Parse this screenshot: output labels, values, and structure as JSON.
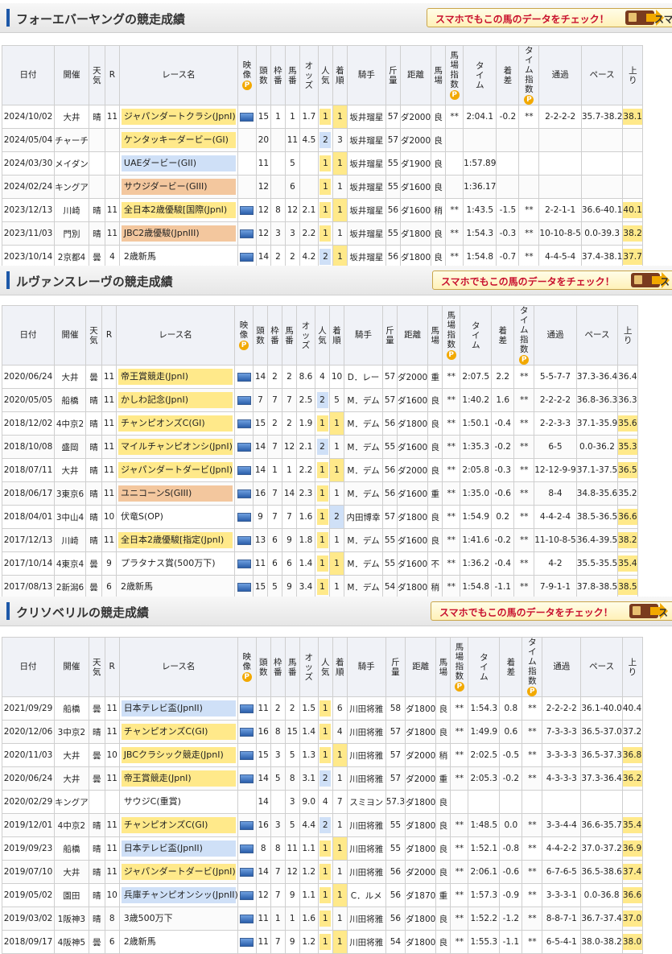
{
  "promo_text": "スマホでもこの馬のデータをチェック！",
  "promo_suffix": "スマ",
  "headers": {
    "date": "日付",
    "venue": "開催",
    "weather": "天気",
    "r": "R",
    "race": "レース名",
    "video": "映像",
    "heads": "頭数",
    "frame": "枠番",
    "horse": "馬番",
    "odds": "オッズ",
    "pop": "人気",
    "finish": "着順",
    "jockey": "騎手",
    "weight": "斤量",
    "distance": "距離",
    "track": "馬場",
    "track_index": "馬場指数",
    "time": "タイム",
    "margin": "着差",
    "time_index": "タイム指数",
    "passing": "通過",
    "pace": "ペース",
    "last3f": "上り",
    "p": "P"
  },
  "horses": [
    {
      "title": "フォーエバーヤングの競走成績",
      "rows": [
        [
          "2024/10/02",
          "大井",
          "晴",
          "11",
          "ジャパンダートクラシ(JpnI)",
          "g1",
          true,
          "15",
          "1",
          "1",
          "1.7",
          "1",
          "1",
          "坂井瑠星",
          "57",
          "ダ2000",
          "良",
          "**",
          "2:04.1",
          "-0.2",
          "**",
          "2-2-2-2",
          "35.7-38.2",
          "38.1"
        ],
        [
          "2024/05/04",
          "チャーチ",
          "",
          "",
          "ケンタッキーダービー(GI)",
          "g1",
          false,
          "20",
          "",
          "11",
          "4.5",
          "2",
          "3",
          "坂井瑠星",
          "57",
          "ダ2000",
          "良",
          "",
          "",
          "",
          "",
          "",
          "",
          ""
        ],
        [
          "2024/03/30",
          "メイダン",
          "",
          "",
          "UAEダービー(GII)",
          "g2",
          false,
          "11",
          "",
          "5",
          "",
          "1",
          "1",
          "坂井瑠星",
          "55",
          "ダ1900",
          "良",
          "",
          "1:57.89",
          "",
          "",
          "",
          "",
          ""
        ],
        [
          "2024/02/24",
          "キングア",
          "",
          "",
          "サウジダービー(GIII)",
          "g3",
          false,
          "12",
          "",
          "6",
          "",
          "1",
          "1",
          "坂井瑠星",
          "55",
          "ダ1600",
          "良",
          "",
          "1:36.17",
          "",
          "",
          "",
          "",
          ""
        ],
        [
          "2023/12/13",
          "川崎",
          "晴",
          "11",
          "全日本2歳優駿[国際(JpnI)",
          "g1",
          true,
          "12",
          "8",
          "12",
          "2.1",
          "1",
          "1",
          "坂井瑠星",
          "56",
          "ダ1600",
          "稍",
          "**",
          "1:43.5",
          "-1.5",
          "**",
          "2-2-1-1",
          "36.6-40.1",
          "40.1"
        ],
        [
          "2023/11/03",
          "門別",
          "晴",
          "11",
          "JBC2歳優駿(JpnIII)",
          "g3",
          true,
          "12",
          "3",
          "3",
          "2.2",
          "1",
          "1",
          "坂井瑠星",
          "55",
          "ダ1800",
          "良",
          "**",
          "1:54.3",
          "-0.3",
          "**",
          "10-10-8-5",
          "0.0-39.3",
          "38.2"
        ],
        [
          "2023/10/14",
          "2京都4",
          "曇",
          "4",
          "2歳新馬",
          "none",
          true,
          "14",
          "2",
          "2",
          "4.2",
          "2",
          "1",
          "坂井瑠星",
          "56",
          "ダ1800",
          "良",
          "**",
          "1:54.8",
          "-0.7",
          "**",
          "4-4-5-4",
          "37.4-38.1",
          "37.7"
        ]
      ]
    },
    {
      "title": "ルヴァンスレーヴの競走成績",
      "rows": [
        [
          "2020/06/24",
          "大井",
          "曇",
          "11",
          "帝王賞競走(JpnI)",
          "g1",
          true,
          "14",
          "2",
          "2",
          "8.6",
          "4",
          "10",
          "D．レー",
          "57",
          "ダ2000",
          "重",
          "**",
          "2:07.5",
          "2.2",
          "**",
          "5-5-7-7",
          "37.3-36.4",
          "36.4"
        ],
        [
          "2020/05/05",
          "船橋",
          "晴",
          "11",
          "かしわ記念(JpnI)",
          "g1",
          true,
          "7",
          "7",
          "7",
          "2.5",
          "2",
          "5",
          "M．デム",
          "57",
          "ダ1600",
          "良",
          "**",
          "1:40.2",
          "1.6",
          "**",
          "2-2-2-2",
          "36.8-36.3",
          "36.3"
        ],
        [
          "2018/12/02",
          "4中京2",
          "晴",
          "11",
          "チャンピオンズC(GI)",
          "g1",
          true,
          "15",
          "2",
          "2",
          "1.9",
          "1",
          "1",
          "M．デム",
          "56",
          "ダ1800",
          "良",
          "**",
          "1:50.1",
          "-0.4",
          "**",
          "2-2-3-3",
          "37.1-35.9",
          "35.6"
        ],
        [
          "2018/10/08",
          "盛岡",
          "晴",
          "11",
          "マイルチャンピオンシ(JpnI)",
          "g1",
          true,
          "14",
          "7",
          "12",
          "2.1",
          "2",
          "1",
          "M．デム",
          "55",
          "ダ1600",
          "良",
          "**",
          "1:35.3",
          "-0.2",
          "**",
          "6-5",
          "0.0-36.2",
          "35.3"
        ],
        [
          "2018/07/11",
          "大井",
          "晴",
          "11",
          "ジャパンダートダービ(JpnI)",
          "g1",
          true,
          "14",
          "1",
          "1",
          "2.2",
          "1",
          "1",
          "M．デム",
          "56",
          "ダ2000",
          "良",
          "**",
          "2:05.8",
          "-0.3",
          "**",
          "12-12-9-9",
          "37.1-37.5",
          "36.5"
        ],
        [
          "2018/06/17",
          "3東京6",
          "晴",
          "11",
          "ユニコーンS(GIII)",
          "g3",
          true,
          "16",
          "7",
          "14",
          "2.3",
          "1",
          "1",
          "M．デム",
          "56",
          "ダ1600",
          "重",
          "**",
          "1:35.0",
          "-0.6",
          "**",
          "8-4",
          "34.8-35.6",
          "35.2"
        ],
        [
          "2018/04/01",
          "3中山4",
          "晴",
          "10",
          "伏竜S(OP)",
          "none",
          true,
          "9",
          "7",
          "7",
          "1.6",
          "1",
          "2",
          "内田博幸",
          "57",
          "ダ1800",
          "良",
          "**",
          "1:54.9",
          "0.2",
          "**",
          "4-4-2-4",
          "38.5-36.5",
          "36.6"
        ],
        [
          "2017/12/13",
          "川崎",
          "晴",
          "11",
          "全日本2歳優駿[指定(JpnI)",
          "g1",
          true,
          "13",
          "6",
          "9",
          "1.8",
          "1",
          "1",
          "M．デム",
          "55",
          "ダ1600",
          "良",
          "**",
          "1:41.6",
          "-0.2",
          "**",
          "11-10-8-5",
          "36.4-39.5",
          "38.2"
        ],
        [
          "2017/10/14",
          "4東京4",
          "曇",
          "9",
          "プラタナス賞(500万下)",
          "none",
          true,
          "11",
          "6",
          "6",
          "1.4",
          "1",
          "1",
          "M．デム",
          "55",
          "ダ1600",
          "不",
          "**",
          "1:36.2",
          "-0.4",
          "**",
          "4-2",
          "35.5-35.5",
          "35.4"
        ],
        [
          "2017/08/13",
          "2新潟6",
          "曇",
          "6",
          "2歳新馬",
          "none",
          true,
          "15",
          "5",
          "9",
          "3.4",
          "1",
          "1",
          "M．デム",
          "54",
          "ダ1800",
          "稍",
          "**",
          "1:54.8",
          "-1.1",
          "**",
          "7-9-1-1",
          "37.8-38.5",
          "38.5"
        ]
      ]
    },
    {
      "title": "クリソベリルの競走成績",
      "rows": [
        [
          "2021/09/29",
          "船橋",
          "曇",
          "11",
          "日本テレビ盃(JpnII)",
          "g2",
          true,
          "11",
          "2",
          "2",
          "1.5",
          "1",
          "6",
          "川田将雅",
          "58",
          "ダ1800",
          "良",
          "**",
          "1:54.3",
          "0.8",
          "**",
          "2-2-2-2",
          "36.1-40.0",
          "40.4"
        ],
        [
          "2020/12/06",
          "3中京2",
          "晴",
          "11",
          "チャンピオンズC(GI)",
          "g1",
          true,
          "16",
          "8",
          "15",
          "1.4",
          "1",
          "4",
          "川田将雅",
          "57",
          "ダ1800",
          "良",
          "**",
          "1:49.9",
          "0.6",
          "**",
          "7-3-3-3",
          "36.5-37.0",
          "37.2"
        ],
        [
          "2020/11/03",
          "大井",
          "曇",
          "10",
          "JBCクラシック競走(JpnI)",
          "g1",
          true,
          "15",
          "3",
          "5",
          "1.3",
          "1",
          "1",
          "川田将雅",
          "57",
          "ダ2000",
          "稍",
          "**",
          "2:02.5",
          "-0.5",
          "**",
          "3-3-3-3",
          "36.5-37.3",
          "36.8"
        ],
        [
          "2020/06/24",
          "大井",
          "曇",
          "11",
          "帝王賞競走(JpnI)",
          "g1",
          true,
          "14",
          "5",
          "8",
          "3.1",
          "2",
          "1",
          "川田将雅",
          "57",
          "ダ2000",
          "重",
          "**",
          "2:05.3",
          "-0.2",
          "**",
          "4-3-3-3",
          "37.3-36.4",
          "36.2"
        ],
        [
          "2020/02/29",
          "キングア",
          "",
          "",
          "サウジC(重賞)",
          "none",
          false,
          "14",
          "",
          "3",
          "9.0",
          "4",
          "7",
          "スミヨン",
          "57.3",
          "ダ1800",
          "良",
          "",
          "",
          "",
          "",
          "",
          "",
          ""
        ],
        [
          "2019/12/01",
          "4中京2",
          "晴",
          "11",
          "チャンピオンズC(GI)",
          "g1",
          true,
          "16",
          "3",
          "5",
          "4.4",
          "2",
          "1",
          "川田将雅",
          "55",
          "ダ1800",
          "良",
          "**",
          "1:48.5",
          "0.0",
          "**",
          "3-3-4-4",
          "36.6-35.7",
          "35.4"
        ],
        [
          "2019/09/23",
          "船橋",
          "晴",
          "11",
          "日本テレビ盃(JpnII)",
          "g2",
          true,
          "8",
          "8",
          "11",
          "1.1",
          "1",
          "1",
          "川田将雅",
          "55",
          "ダ1800",
          "良",
          "**",
          "1:52.1",
          "-0.8",
          "**",
          "4-4-2-2",
          "37.0-37.2",
          "36.9"
        ],
        [
          "2019/07/10",
          "大井",
          "晴",
          "11",
          "ジャパンダートダービ(JpnI)",
          "g1",
          true,
          "14",
          "7",
          "12",
          "1.2",
          "1",
          "1",
          "川田将雅",
          "56",
          "ダ2000",
          "良",
          "**",
          "2:06.1",
          "-0.6",
          "**",
          "6-7-6-5",
          "36.5-38.6",
          "37.4"
        ],
        [
          "2019/05/02",
          "園田",
          "晴",
          "10",
          "兵庫チャンピオンシッ(JpnII)",
          "g2",
          true,
          "12",
          "7",
          "9",
          "1.1",
          "1",
          "1",
          "C．ルメ",
          "56",
          "ダ1870",
          "重",
          "**",
          "1:57.3",
          "-0.9",
          "**",
          "3-3-3-1",
          "0.0-36.8",
          "36.6"
        ],
        [
          "2019/03/02",
          "1阪神3",
          "晴",
          "8",
          "3歳500万下",
          "none",
          true,
          "11",
          "1",
          "1",
          "1.6",
          "1",
          "1",
          "川田将雅",
          "56",
          "ダ1800",
          "良",
          "**",
          "1:52.2",
          "-1.2",
          "**",
          "8-8-7-1",
          "36.7-37.4",
          "37.0"
        ],
        [
          "2018/09/17",
          "4阪神5",
          "曇",
          "6",
          "2歳新馬",
          "none",
          true,
          "11",
          "7",
          "9",
          "1.2",
          "1",
          "1",
          "川田将雅",
          "54",
          "ダ1800",
          "良",
          "**",
          "1:55.3",
          "-1.1",
          "**",
          "6-5-4-1",
          "38.0-38.2",
          "38.0"
        ]
      ]
    }
  ],
  "colors": {
    "accent": "#1d58a8",
    "g1": "#ffe98a",
    "g2": "#cfe0f7",
    "g3": "#f3c79e",
    "promo_text": "#c8102e"
  }
}
